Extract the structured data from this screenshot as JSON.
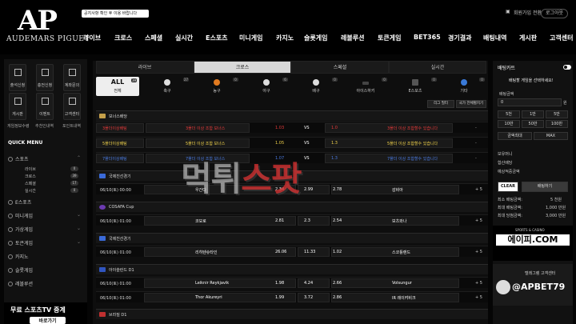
{
  "header": {
    "logo_text": "AP",
    "logo_sub": "AUDEMARS PIGUET",
    "notice": "공지사항 확인 후 이용 바랍니다",
    "user_link": "회원가입 전환",
    "login_button": "로그아웃",
    "nav": [
      "라이브",
      "크로스",
      "스페셜",
      "실시간",
      "E스포츠",
      "미니게임",
      "카지노",
      "슬롯게임",
      "레볼루션",
      "토큰게임",
      "BET365",
      "경기결과",
      "배팅내역",
      "게시판",
      "고객센터"
    ]
  },
  "sidebar": {
    "icons": [
      "출석신청",
      "충전신청",
      "계좌문의",
      "게시판",
      "이벤트",
      "고객센터"
    ],
    "links": [
      "게임정보수령",
      "추천인내역",
      "포인트내역"
    ],
    "quick_menu": "QUICK MENU",
    "sports": "스포츠",
    "sports_sub": [
      {
        "label": "라이브",
        "count": "0"
      },
      {
        "label": "크로스",
        "count": "39"
      },
      {
        "label": "스페셜",
        "count": "17"
      },
      {
        "label": "실시간",
        "count": "0"
      }
    ],
    "menu": [
      "E스포츠",
      "미니게임",
      "가상게임",
      "토큰게임",
      "카지노",
      "슬롯게임",
      "레볼루션"
    ],
    "banner_title": "무료 스포츠TV 중계",
    "banner_button": "바로가기"
  },
  "main": {
    "tabs": [
      "라이브",
      "크로스",
      "스페셜",
      "실시간"
    ],
    "all": {
      "title": "ALL",
      "label": "전체",
      "count": "39"
    },
    "categories": [
      {
        "label": "축구",
        "count": "27"
      },
      {
        "label": "농구",
        "count": "0"
      },
      {
        "label": "야구",
        "count": "6"
      },
      {
        "label": "배구",
        "count": "0"
      },
      {
        "label": "아이스하키",
        "count": "0"
      },
      {
        "label": "E스포츠",
        "count": "0"
      },
      {
        "label": "기타",
        "count": "0"
      }
    ],
    "toolbar": [
      "리그 필터",
      "국가 전체펼치기"
    ],
    "leagues": [
      {
        "name": "보너스배당"
      },
      {
        "name": "국제친선경기"
      },
      {
        "name": "COSAFA Cup"
      },
      {
        "name": "국제친선경기"
      },
      {
        "name": "아이슬란드 D1"
      },
      {
        "name": "브라질 D1"
      }
    ],
    "bonus_rows": [
      {
        "left": "3폴더이상배팅",
        "home": "3폴더 이상 조합 보너스",
        "o1": "1.03",
        "vs": "VS",
        "o2": "1.0",
        "away": "3폴더 이상 조합할수 있습니다",
        "cls": "r"
      },
      {
        "left": "5폴더이상배팅",
        "home": "5폴더 이상 조합 보너스",
        "o1": "1.05",
        "vs": "VS",
        "o2": "1.3",
        "away": "5폴더 이상 조합할수 있습니다",
        "cls": "y"
      },
      {
        "left": "7폴더이상배팅",
        "home": "7폴더 이상 조합 보너스",
        "o1": "1.07",
        "vs": "VS",
        "o2": "1.3",
        "away": "7폴더 이상 조합할수 있습니다",
        "cls": "b"
      }
    ],
    "matches": [
      {
        "league": 1,
        "time": "06/10(토) 00:00",
        "home": "우간다",
        "o1": "2.34",
        "x": "2.99",
        "o2": "2.78",
        "away": "감비아",
        "more": "+ 5"
      },
      {
        "league": 2,
        "time": "06/10(토) 01:00",
        "home": "코모로",
        "o1": "2.81",
        "x": "2.3",
        "o2": "2.54",
        "away": "보츠와나",
        "more": "+ 5"
      },
      {
        "league": 3,
        "time": "06/10(토) 01:00",
        "home": "리히텐슈타인",
        "o1": "26.06",
        "x": "11.33",
        "o2": "1.02",
        "away": "스코틀랜드",
        "more": "+ 5"
      },
      {
        "league": 4,
        "time": "06/10(토) 01:00",
        "home": "Leiknir Reykjavik",
        "o1": "1.98",
        "x": "4.24",
        "o2": "2.66",
        "away": "Volsungur",
        "more": "+ 5"
      },
      {
        "league": 4,
        "time": "06/10(토) 01:00",
        "home": "Thor Akureyri",
        "o1": "1.99",
        "x": "3.72",
        "o2": "2.86",
        "away": "IR 레이캬비크",
        "more": "+ 5"
      }
    ],
    "watermark_a": "먹튀",
    "watermark_b": "스팟"
  },
  "cart": {
    "title": "배팅카트",
    "empty": "배팅할 게임을 선택하세요!",
    "amount_label": "배팅금액",
    "amount_value": "0",
    "amount_unit": "원",
    "quick": [
      "5천",
      "1만",
      "5만",
      "10만",
      "50만",
      "100만",
      "금액최대",
      "MAX"
    ],
    "labels": [
      "보유머니",
      "합산배당",
      "예상적중금액"
    ],
    "clear": "CLEAR",
    "bet": "배팅하기",
    "limits": [
      {
        "k": "최소 배팅금액:",
        "v": "5 천원"
      },
      {
        "k": "최대 배팅금액:",
        "v": "1,000 만원"
      },
      {
        "k": "최대 당첨금액:",
        "v": "3,000 만원"
      }
    ],
    "ad1": "에이피.COM",
    "ad1_sub": "SPORTS & CASINO",
    "ad2_top": "텔레그램 고객센터",
    "ad2": "@APBET79"
  },
  "colors": {
    "accent": "#c5a04a",
    "red": "#e43a3a",
    "yellow": "#f1d34b",
    "blue": "#4a7ae0"
  }
}
